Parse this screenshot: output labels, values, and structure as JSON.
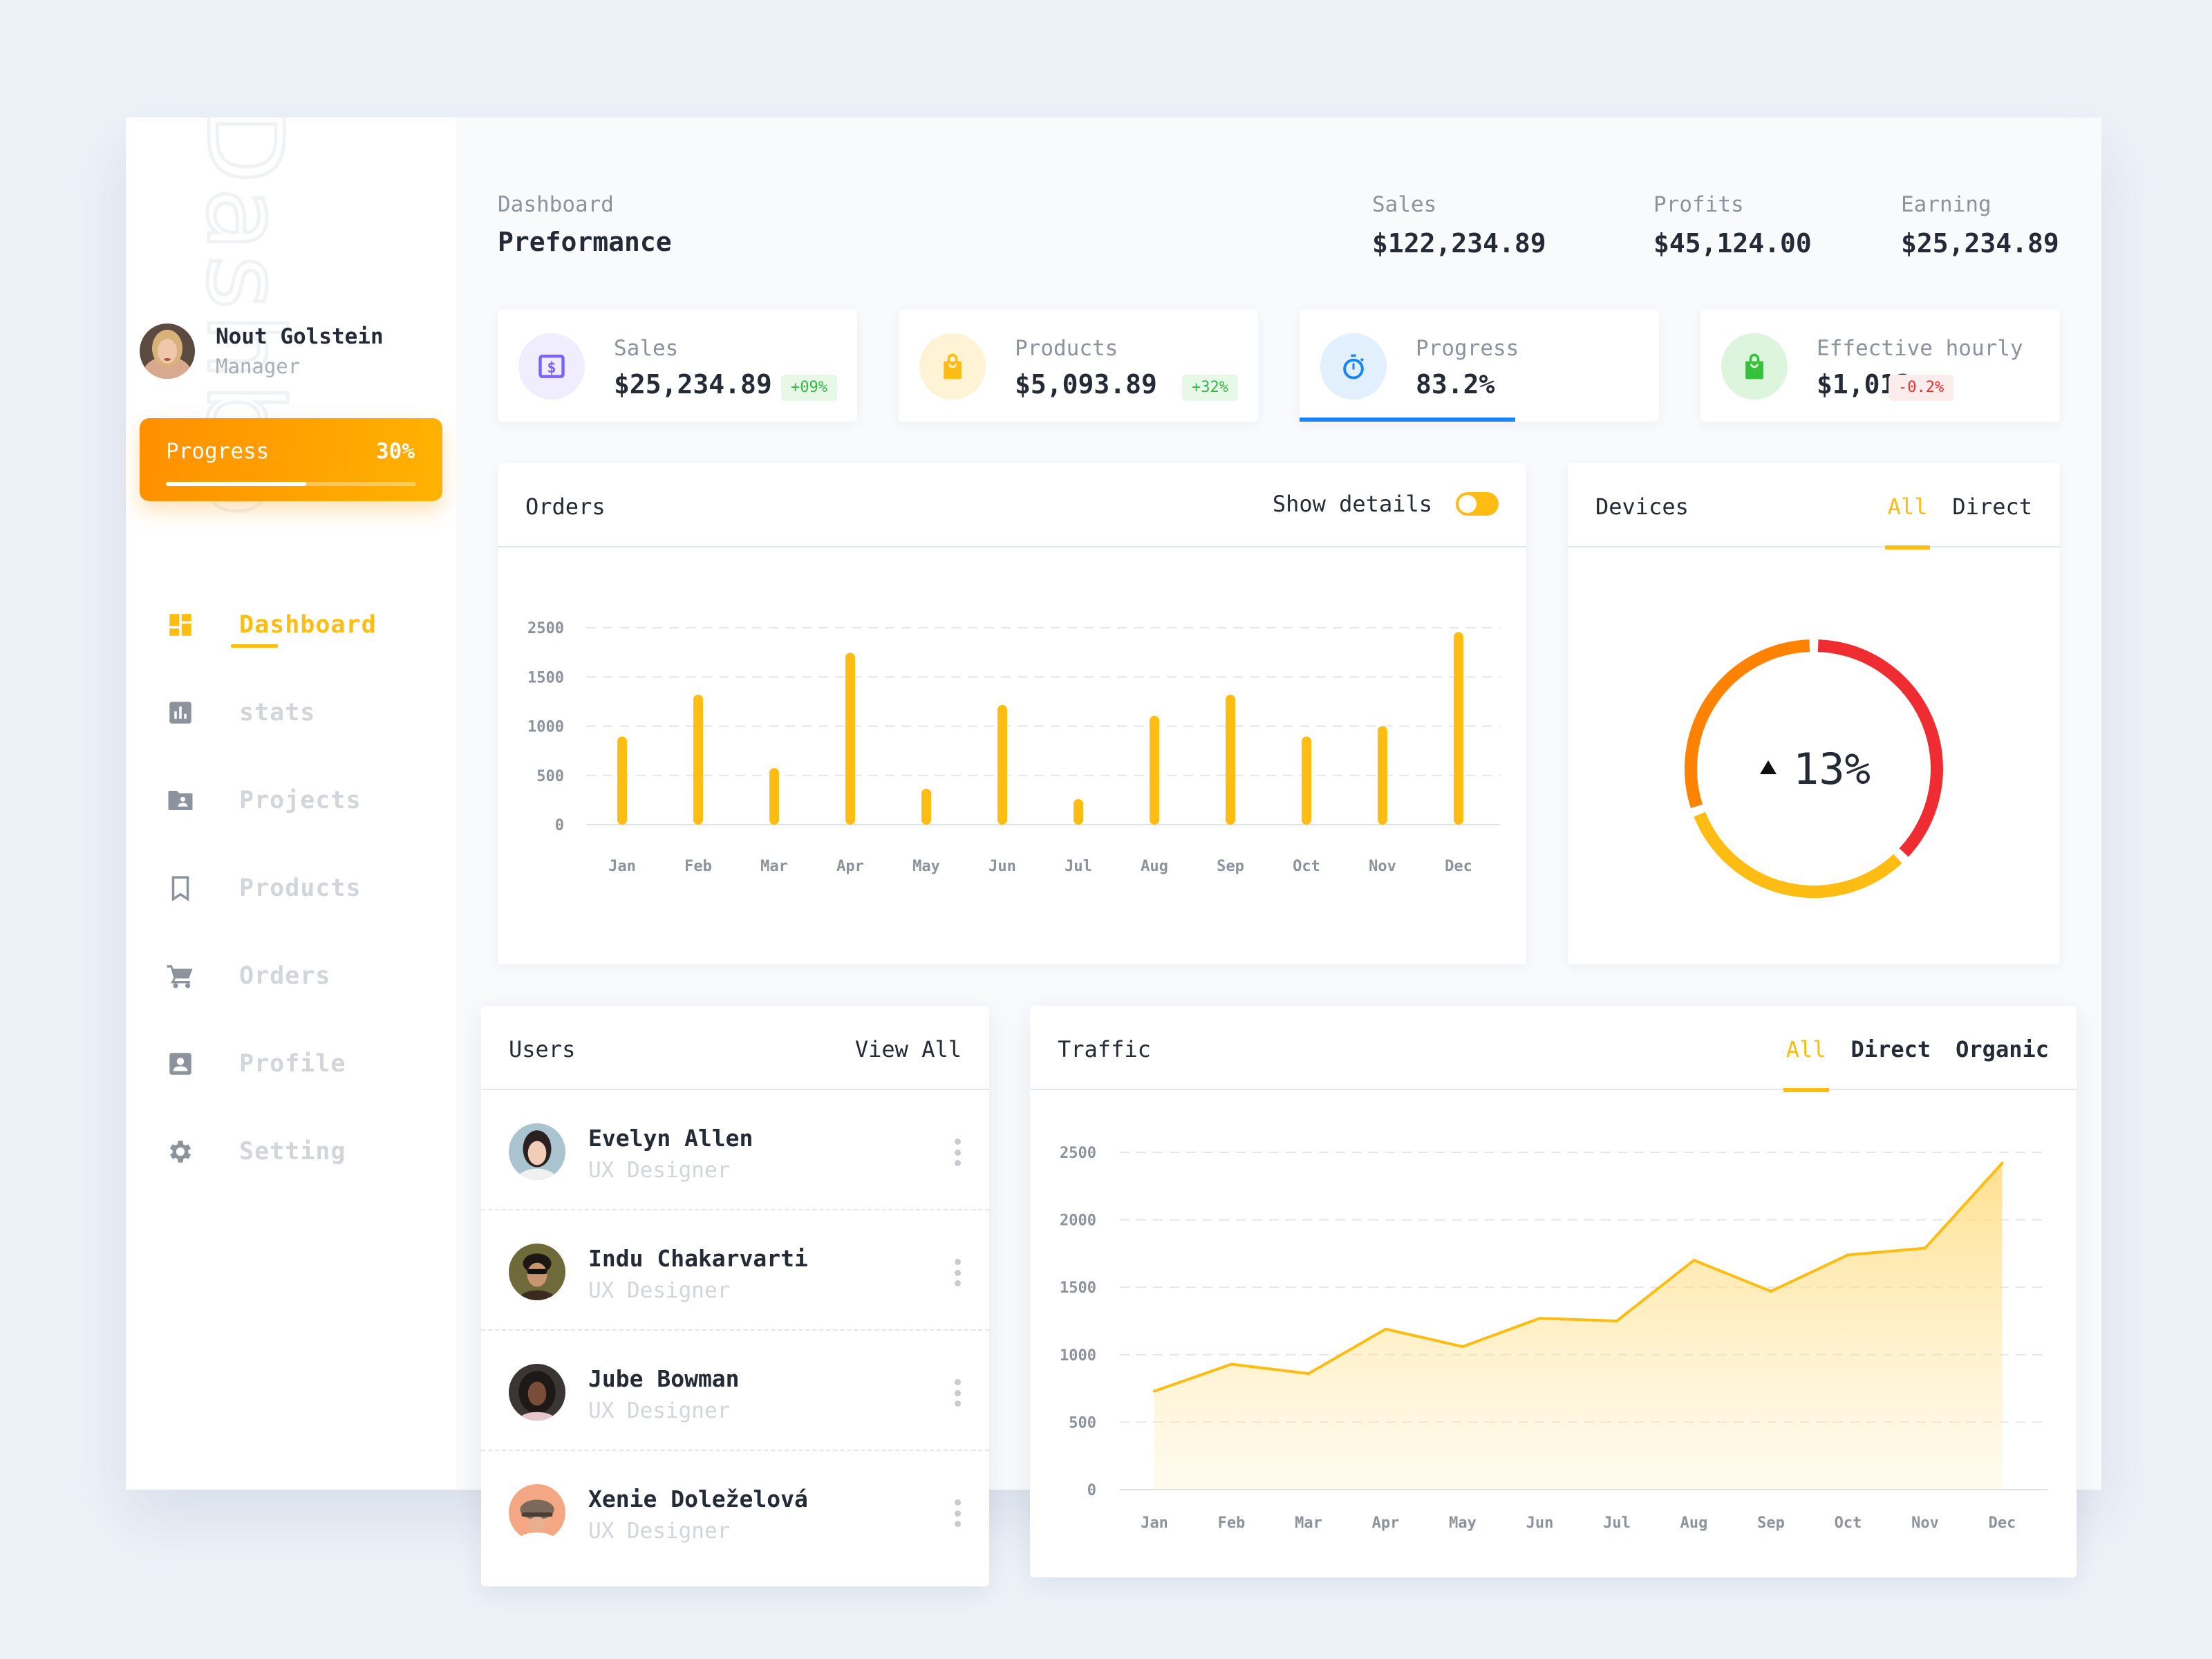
{
  "sidebar": {
    "watermark": "Dashboard",
    "user": {
      "name": "Nout Golstein",
      "role": "Manager"
    },
    "progress": {
      "label": "Progress",
      "value_text": "30%",
      "fraction": 0.56
    },
    "items": [
      {
        "label": "Dashboard",
        "icon": "dashboard-icon",
        "active": true
      },
      {
        "label": "stats",
        "icon": "bar-chart-icon",
        "active": false
      },
      {
        "label": "Projects",
        "icon": "folder-user-icon",
        "active": false
      },
      {
        "label": "Products",
        "icon": "bookmark-icon",
        "active": false
      },
      {
        "label": "Orders",
        "icon": "cart-icon",
        "active": false
      },
      {
        "label": "Profile",
        "icon": "profile-card-icon",
        "active": false
      },
      {
        "label": "Setting",
        "icon": "gear-icon",
        "active": false
      }
    ]
  },
  "header": {
    "breadcrumb": "Dashboard",
    "title": "Preformance",
    "stats": [
      {
        "label": "Sales",
        "value": "$122,234.89"
      },
      {
        "label": "Profits",
        "value": "$45,124.00"
      },
      {
        "label": "Earning",
        "value": "$25,234.89"
      }
    ]
  },
  "stat_cards": [
    {
      "label": "Sales",
      "value": "$25,234.89",
      "badge": "+09%",
      "trend": "up",
      "icon": "dollar-bill-icon",
      "color": "#7b61ff",
      "bg": "#f0edff"
    },
    {
      "label": "Products",
      "value": "$5,093.89",
      "badge": "+32%",
      "trend": "up",
      "icon": "shopping-bag-icon",
      "color": "#ffbc12",
      "bg": "#fff3d6"
    },
    {
      "label": "Progress",
      "value": "83.2%",
      "icon": "stopwatch-icon",
      "color": "#1a85f5",
      "bg": "#e2f0fe",
      "progress_fraction": 0.6
    },
    {
      "label": "Effective hourly",
      "value": "$1,012",
      "badge": "-0.2%",
      "trend": "down",
      "icon": "shopping-bag-icon",
      "color": "#35c13c",
      "bg": "#dcf5dc"
    }
  ],
  "orders": {
    "title": "Orders",
    "toggle_label": "Show details",
    "toggle_on": false
  },
  "devices": {
    "title": "Devices",
    "tabs": [
      "All",
      "Direct"
    ],
    "active_tab": 0,
    "center_value": "13%",
    "trend": "up"
  },
  "users": {
    "title": "Users",
    "view_all": "View All",
    "list": [
      {
        "name": "Evelyn Allen",
        "role": "UX Designer"
      },
      {
        "name": "Indu Chakarvarti",
        "role": "UX Designer"
      },
      {
        "name": "Jube Bowman",
        "role": "UX Designer"
      },
      {
        "name": "Xenie Doleželová",
        "role": "UX Designer"
      }
    ]
  },
  "traffic": {
    "title": "Traffic",
    "tabs": [
      "All",
      "Direct",
      "Organic"
    ],
    "active_tab": 0
  },
  "colors": {
    "accent": "#ffbc12",
    "text": "#252a37",
    "muted": "#8d939c",
    "blue": "#1a85f5",
    "red": "#ee2f2f",
    "green": "#35c13c"
  },
  "chart_data": [
    {
      "type": "bar",
      "title": "Orders",
      "categories": [
        "Jan",
        "Feb",
        "Mar",
        "Apr",
        "May",
        "Jun",
        "Jul",
        "Aug",
        "Sep",
        "Oct",
        "Nov",
        "Dec"
      ],
      "values": [
        895,
        1320,
        575,
        1745,
        365,
        1215,
        260,
        1105,
        1320,
        895,
        1000,
        1955
      ],
      "ytick_values": [
        0,
        500,
        1000,
        1500,
        2000
      ],
      "ytick_labels": [
        "0",
        "500",
        "1000",
        "1500",
        "2500"
      ],
      "ylim": [
        0,
        2000
      ],
      "grid": true,
      "xlabel": "",
      "ylabel": "",
      "color": "#ffbc12"
    },
    {
      "type": "pie",
      "title": "Devices",
      "variant": "donut",
      "center_label": "13%",
      "slices": [
        {
          "name": "segment-red",
          "value": 37.5,
          "color": "#ef2c31"
        },
        {
          "name": "segment-yellow",
          "value": 32,
          "color": "#ffbc12"
        },
        {
          "name": "segment-orange",
          "value": 30.5,
          "color": "#ff8300"
        }
      ]
    },
    {
      "type": "area",
      "title": "Traffic",
      "categories": [
        "Jan",
        "Feb",
        "Mar",
        "Apr",
        "May",
        "Jun",
        "Jul",
        "Aug",
        "Sep",
        "Oct",
        "Nov",
        "Dec"
      ],
      "values": [
        730,
        930,
        860,
        1190,
        1060,
        1270,
        1250,
        1700,
        1470,
        1740,
        1790,
        2420
      ],
      "ytick_labels": [
        "0",
        "500",
        "1000",
        "1500",
        "2000",
        "2500"
      ],
      "ylim": [
        0,
        2500
      ],
      "grid": true,
      "xlabel": "",
      "ylabel": "",
      "color": "#ffbc12"
    }
  ]
}
